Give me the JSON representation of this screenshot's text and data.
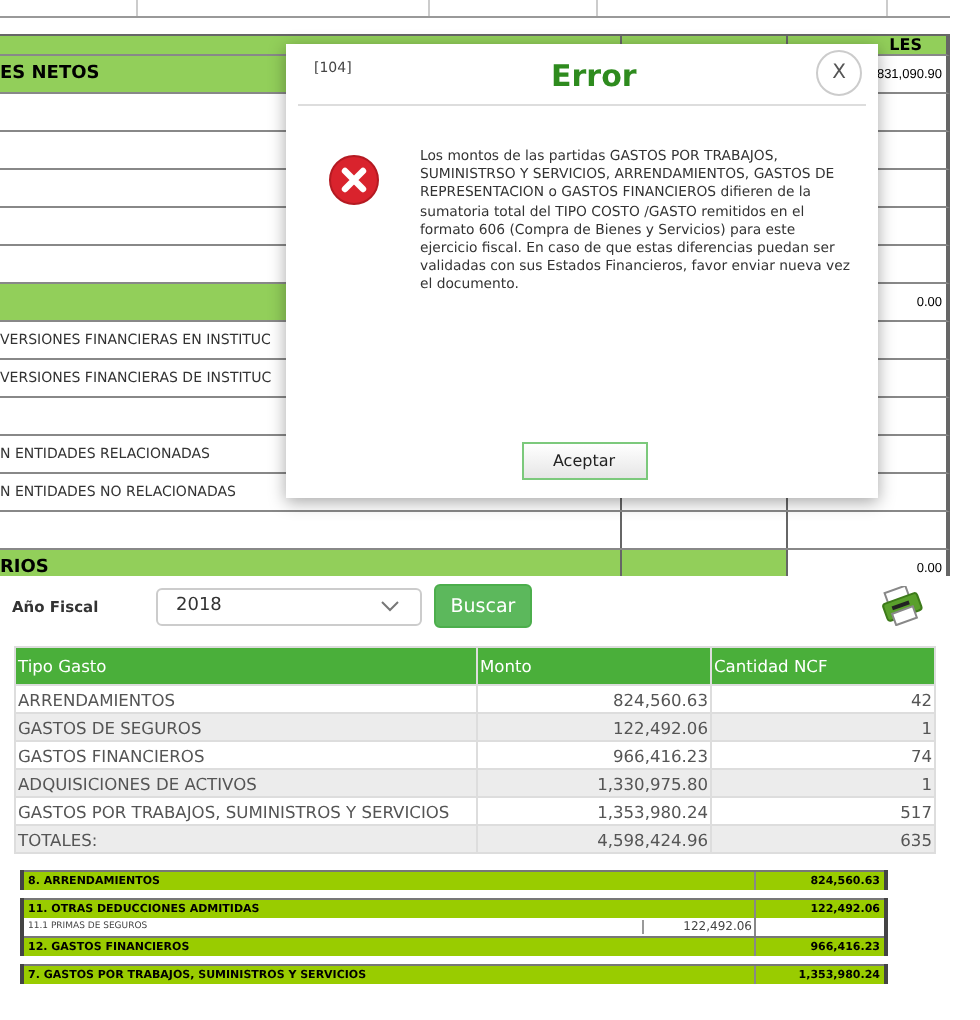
{
  "background_form": {
    "header_total_label": "LES",
    "rows": [
      {
        "kind": "section",
        "label": "ES NETOS",
        "amount": "",
        "total": "831,090.90"
      },
      {
        "kind": "row",
        "label": "",
        "amount": "",
        "total": ""
      },
      {
        "kind": "row",
        "label": "",
        "amount": "",
        "total": ""
      },
      {
        "kind": "row",
        "label": "",
        "amount": "",
        "total": ""
      },
      {
        "kind": "row",
        "label": "",
        "amount": "",
        "total": ""
      },
      {
        "kind": "row",
        "label": "",
        "amount": "",
        "total": ""
      },
      {
        "kind": "section",
        "label": "",
        "amount": "",
        "total": "0.00"
      },
      {
        "kind": "row",
        "label": "VERSIONES FINANCIERAS EN INSTITUC",
        "amount": "",
        "total": ""
      },
      {
        "kind": "row",
        "label": "VERSIONES FINANCIERAS DE INSTITUC",
        "amount": "",
        "total": ""
      },
      {
        "kind": "row",
        "label": "",
        "amount": "",
        "total": ""
      },
      {
        "kind": "row",
        "label": "N ENTIDADES RELACIONADAS",
        "amount": "",
        "total": ""
      },
      {
        "kind": "row",
        "label": "N ENTIDADES NO RELACIONADAS",
        "amount": "",
        "total": ""
      },
      {
        "kind": "row",
        "label": "",
        "amount": "",
        "total": ""
      },
      {
        "kind": "section",
        "label": "RIOS",
        "amount": "",
        "total": "0.00"
      }
    ]
  },
  "modal": {
    "code": "[104]",
    "title": "Error",
    "close": "X",
    "message": "Los montos de las partidas GASTOS POR TRABAJOS, SUMINISTRSO Y SERVICIOS, ARRENDAMIENTOS, GASTOS DE REPRESENTACION o GASTOS FINANCIEROS difieren de la sumatoria total del TIPO COSTO /GASTO remitidos en el formato 606 (Compra de Bienes y Servicios) para este ejercicio fiscal. En caso de que estas diferencias puedan ser validadas con sus Estados Financieros, favor enviar nueva vez el documento.",
    "button": "Aceptar"
  },
  "filter": {
    "label": "Año Fiscal",
    "year": "2018",
    "button": "Buscar"
  },
  "table": {
    "columns": [
      "Tipo Gasto",
      "Monto",
      "Cantidad NCF"
    ],
    "rows": [
      {
        "tipo": "ARRENDAMIENTOS",
        "monto": "824,560.63",
        "cantidad": "42"
      },
      {
        "tipo": "GASTOS DE SEGUROS",
        "monto": "122,492.06",
        "cantidad": "1"
      },
      {
        "tipo": "GASTOS FINANCIEROS",
        "monto": "966,416.23",
        "cantidad": "74"
      },
      {
        "tipo": "ADQUISICIONES DE ACTIVOS",
        "monto": "1,330,975.80",
        "cantidad": "1"
      },
      {
        "tipo": "GASTOS POR TRABAJOS, SUMINISTROS Y SERVICIOS",
        "monto": "1,353,980.24",
        "cantidad": "517"
      },
      {
        "tipo": "TOTALES:",
        "monto": "4,598,424.96",
        "cantidad": "635"
      }
    ]
  },
  "report_groups": [
    [
      {
        "kind": "section",
        "label": "8. ARRENDAMIENTOS",
        "value": "824,560.63"
      }
    ],
    [
      {
        "kind": "section",
        "label": "11. OTRAS DEDUCCIONES ADMITIDAS",
        "value": "122,492.06"
      },
      {
        "kind": "sub",
        "label": "11.1 PRIMAS DE SEGUROS",
        "value": "122,492.06"
      },
      {
        "kind": "section",
        "label": "12. GASTOS FINANCIEROS",
        "value": "966,416.23"
      }
    ],
    [
      {
        "kind": "section",
        "label": "7. GASTOS POR TRABAJOS, SUMINISTROS Y SERVICIOS",
        "value": "1,353,980.24"
      }
    ]
  ]
}
